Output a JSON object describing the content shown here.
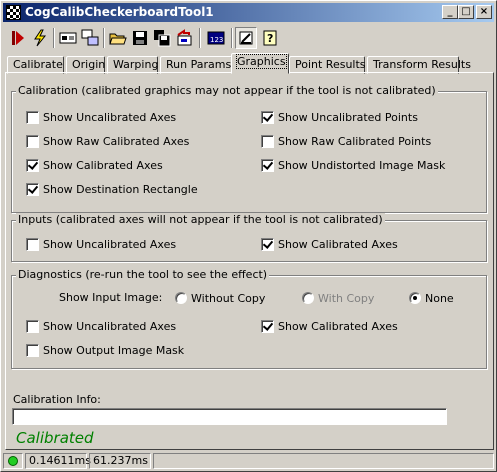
{
  "window": {
    "title": "CogCalibCheckerboardTool1",
    "buttons": {
      "minimize": "_",
      "maximize": "□",
      "close": "×"
    }
  },
  "toolbar": {
    "icons": [
      "run-icon",
      "electric-run-icon",
      "image-source-icon",
      "local-display-icon",
      "open-folder-icon",
      "save-icon",
      "save-as-icon",
      "reset-icon",
      "terminal-icon",
      "show-graphics-icon",
      "help-icon"
    ]
  },
  "tabs": [
    "Calibrate",
    "Origin",
    "Warping",
    "Run Params",
    "Graphics",
    "Point Results",
    "Transform Results"
  ],
  "active_tab": "Graphics",
  "calibration": {
    "legend": "Calibration (calibrated graphics may not appear if the tool is not calibrated)",
    "left": [
      {
        "label": "Show Uncalibrated Axes",
        "checked": false
      },
      {
        "label": "Show Raw Calibrated Axes",
        "checked": false
      },
      {
        "label": "Show Calibrated Axes",
        "checked": true
      },
      {
        "label": "Show Destination Rectangle",
        "checked": true
      }
    ],
    "right": [
      {
        "label": "Show Uncalibrated Points",
        "checked": true
      },
      {
        "label": "Show Raw Calibrated Points",
        "checked": false
      },
      {
        "label": "Show Undistorted Image Mask",
        "checked": true
      }
    ]
  },
  "inputs": {
    "legend": "Inputs (calibrated axes will not appear if the tool is not calibrated)",
    "uncal": {
      "label": "Show Uncalibrated Axes",
      "checked": false
    },
    "cal": {
      "label": "Show Calibrated Axes",
      "checked": true
    }
  },
  "diagnostics": {
    "legend": "Diagnostics (re-run the tool to see the effect)",
    "input_image_label": "Show Input Image:",
    "radios": [
      {
        "label": "Without Copy",
        "checked": false,
        "disabled": false
      },
      {
        "label": "With Copy",
        "checked": false,
        "disabled": true
      },
      {
        "label": "None",
        "checked": true,
        "disabled": false
      }
    ],
    "uncal": {
      "label": "Show Uncalibrated Axes",
      "checked": false
    },
    "cal": {
      "label": "Show Calibrated Axes",
      "checked": true
    },
    "mask": {
      "label": "Show Output Image Mask",
      "checked": false
    }
  },
  "calibration_info": {
    "label": "Calibration Info:",
    "value": ""
  },
  "status_text": "Calibrated",
  "status_color": "#008000",
  "statusbar": {
    "time1": "0.14611ms",
    "time2": "61.237ms",
    "indicator_color": "#22cc22"
  }
}
